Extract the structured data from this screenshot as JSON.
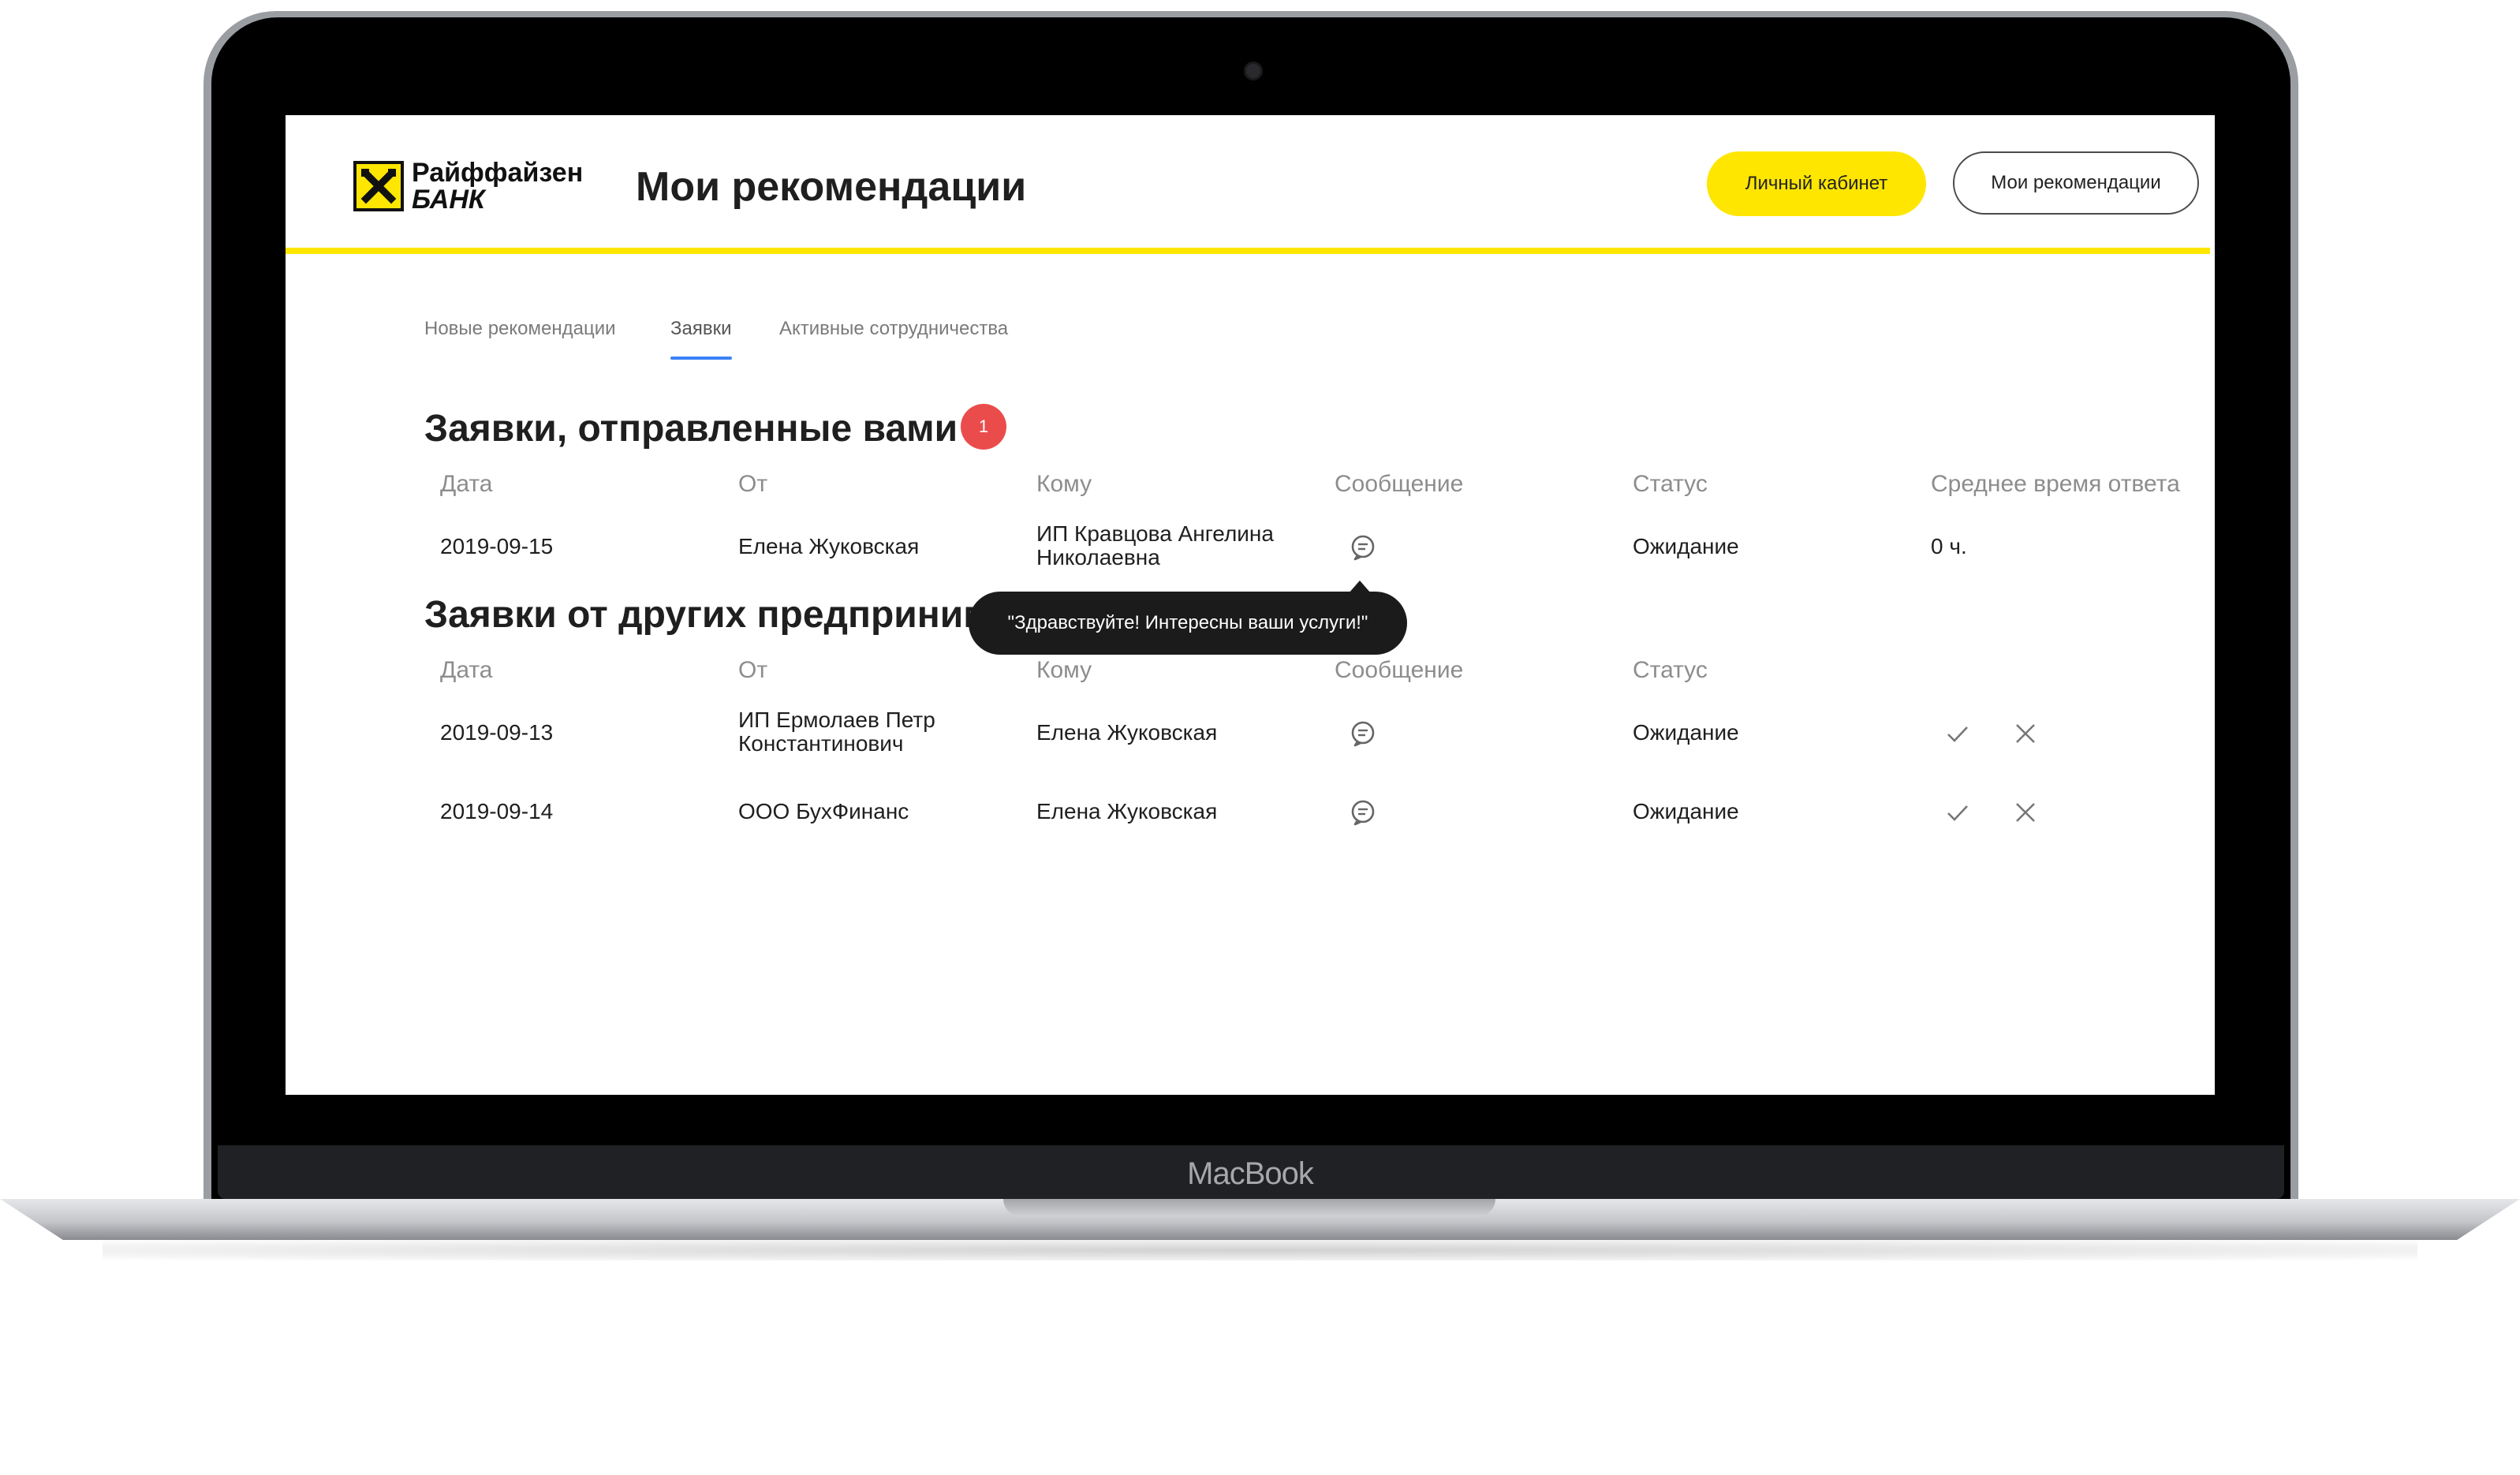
{
  "device": {
    "brand": "MacBook"
  },
  "header": {
    "logo": {
      "line1": "Райффайзен",
      "line2": "БАНК"
    },
    "title": "Мои рекомендации",
    "buttons": {
      "cabinet": "Личный кабинет",
      "recommendations": "Мои рекомендации"
    }
  },
  "colors": {
    "brand_yellow": "#fee600",
    "badge_red": "#ea4c4c",
    "tab_active": "#3b82f6",
    "tooltip_bg": "#1b1b1b"
  },
  "tabs": [
    {
      "label": "Новые рекомендации",
      "active": false
    },
    {
      "label": "Заявки",
      "active": true
    },
    {
      "label": "Активные сотрудничества",
      "active": false
    }
  ],
  "sent": {
    "title": "Заявки, отправленные вами",
    "badge": "1",
    "columns": [
      "Дата",
      "От",
      "Кому",
      "Сообщение",
      "Статус",
      "Среднее время ответа"
    ],
    "rows": [
      {
        "date": "2019-09-15",
        "from": "Елена Жуковская",
        "to": "ИП Кравцова Ангелина Николаевна",
        "message_icon": "message-icon",
        "status": "Ожидание",
        "avg_time": "0 ч."
      }
    ]
  },
  "tooltip": {
    "text": "\"Здравствуйте! Интересны ваши услуги!\""
  },
  "incoming": {
    "title": "Заявки от других предпринимателей",
    "columns": [
      "Дата",
      "От",
      "Кому",
      "Сообщение",
      "Статус"
    ],
    "rows": [
      {
        "date": "2019-09-13",
        "from": "ИП Ермолаев Петр Константинович",
        "to": "Елена Жуковская",
        "message_icon": "message-icon",
        "status": "Ожидание",
        "actions": [
          "check-icon",
          "close-icon"
        ]
      },
      {
        "date": "2019-09-14",
        "from": "ООО БухФинанс",
        "to": "Елена Жуковская",
        "message_icon": "message-icon",
        "status": "Ожидание",
        "actions": [
          "check-icon",
          "close-icon"
        ]
      }
    ]
  }
}
